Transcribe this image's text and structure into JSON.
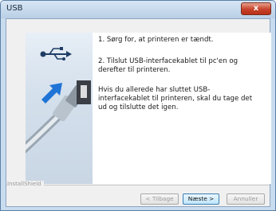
{
  "window": {
    "title": "USB",
    "close_label": "x"
  },
  "steps": [
    "1. Sørg for, at printeren er tændt.",
    "2. Tilslut USB-interfacekablet til pc'en og deref​ter til printeren.",
    "Hvis du allerede har sluttet USB-interfacekablet til printeren, skal du tage det ud og tilslutte det igen."
  ],
  "footer": {
    "brand": "InstallShield",
    "back_label": "< Tilbage",
    "next_label": "Næste >",
    "cancel_label": "Annuller"
  },
  "colors": {
    "accent_blue": "#1f74d6",
    "button_focus": "#3c7fb1",
    "close_red": "#c7422a"
  },
  "icons": [
    "usb-symbol-icon",
    "arrow-icon",
    "usb-cable-icon"
  ]
}
